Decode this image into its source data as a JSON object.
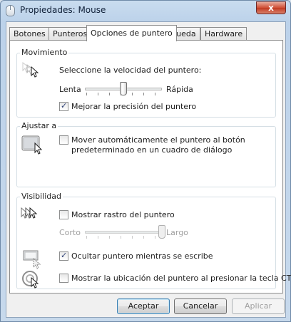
{
  "window": {
    "title": "Propiedades: Mouse",
    "close_label": "x"
  },
  "tabs": [
    {
      "label": "Botones",
      "active": false
    },
    {
      "label": "Punteros",
      "active": false
    },
    {
      "label": "Opciones de puntero",
      "active": true
    },
    {
      "label": "Rueda",
      "active": false
    },
    {
      "label": "Hardware",
      "active": false
    }
  ],
  "movimiento": {
    "legend": "Movimiento",
    "speed_label": "Seleccione la velocidad del puntero:",
    "slow_label": "Lenta",
    "fast_label": "Rápida",
    "speed_value": 0.5,
    "precision": {
      "label": "Mejorar la precisión del puntero",
      "checked": true
    }
  },
  "ajustar": {
    "legend": "Ajustar a",
    "snap": {
      "label_line1": "Mover automáticamente el puntero al botón",
      "label_line2": "predeterminado en un cuadro de diálogo",
      "checked": false
    }
  },
  "visibilidad": {
    "legend": "Visibilidad",
    "trails": {
      "label": "Mostrar rastro del puntero",
      "checked": false
    },
    "short_label": "Corto",
    "long_label": "Largo",
    "trail_value": 1.0,
    "hide_typing": {
      "label": "Ocultar puntero mientras se escribe",
      "checked": true
    },
    "show_ctrl": {
      "label": "Mostrar la ubicación del puntero al presionar la tecla CTRL",
      "checked": false
    }
  },
  "buttons": {
    "ok": "Aceptar",
    "cancel": "Cancelar",
    "apply": "Aplicar"
  }
}
